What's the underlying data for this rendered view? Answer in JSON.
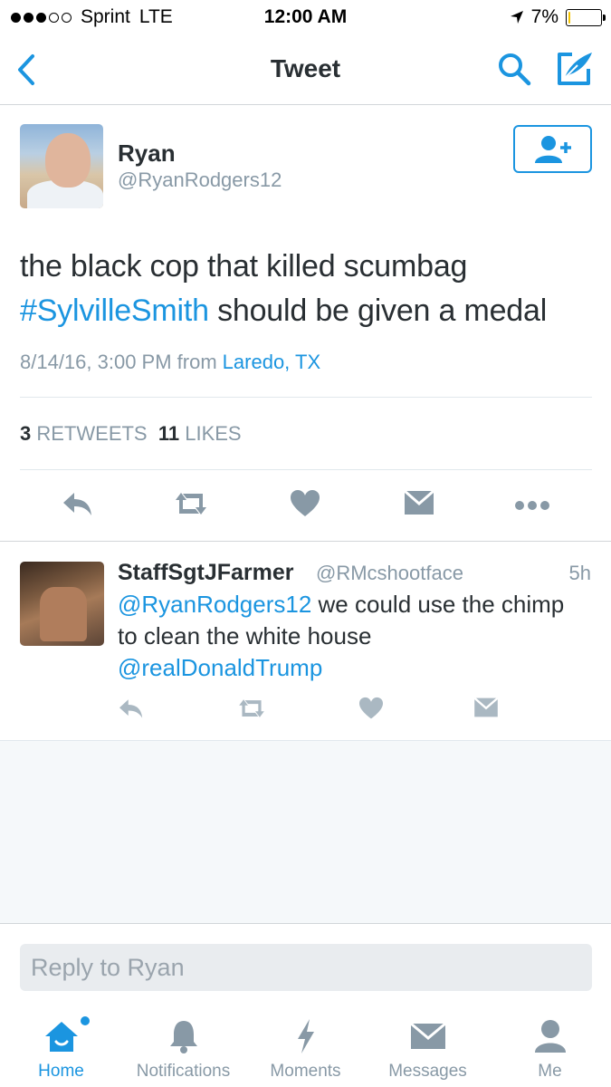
{
  "status_bar": {
    "carrier": "Sprint",
    "network": "LTE",
    "time": "12:00 AM",
    "battery": "7%",
    "battery_level": 0.07,
    "signal_bars_filled": 3,
    "signal_bars_total": 5
  },
  "nav": {
    "title": "Tweet",
    "back_icon": "chevron-left-icon",
    "search_icon": "search-icon",
    "compose_icon": "compose-tweet-icon"
  },
  "tweet": {
    "author_name": "Ryan",
    "author_handle": "@RyanRodgers12",
    "text_before": "the black cop that killed scumbag",
    "hashtag": "#SylvilleSmith",
    "text_after": "should be given a medal",
    "timestamp": "8/14/16, 3:00 PM from",
    "location": "Laredo, TX",
    "retweet_count": "3",
    "retweet_label": "RETWEETS",
    "like_count": "11",
    "like_label": "LIKES"
  },
  "reply": {
    "author_name": "StaffSgtJFarmer",
    "author_handle": "@RMcshootface",
    "time": "5h",
    "mention1": "@RyanRodgers12",
    "text": "we could use the chimp to clean the white house",
    "mention2": "@realDonaldTrump"
  },
  "reply_bar": {
    "placeholder": "Reply to Ryan"
  },
  "tabs": [
    {
      "label": "Home",
      "icon": "home-icon"
    },
    {
      "label": "Notifications",
      "icon": "bell-icon"
    },
    {
      "label": "Moments",
      "icon": "lightning-icon"
    },
    {
      "label": "Messages",
      "icon": "envelope-icon"
    },
    {
      "label": "Me",
      "icon": "person-icon"
    }
  ],
  "colors": {
    "accent": "#1b95e0",
    "muted": "#8899a6",
    "text": "#292f33",
    "battery": "#f5c400"
  }
}
